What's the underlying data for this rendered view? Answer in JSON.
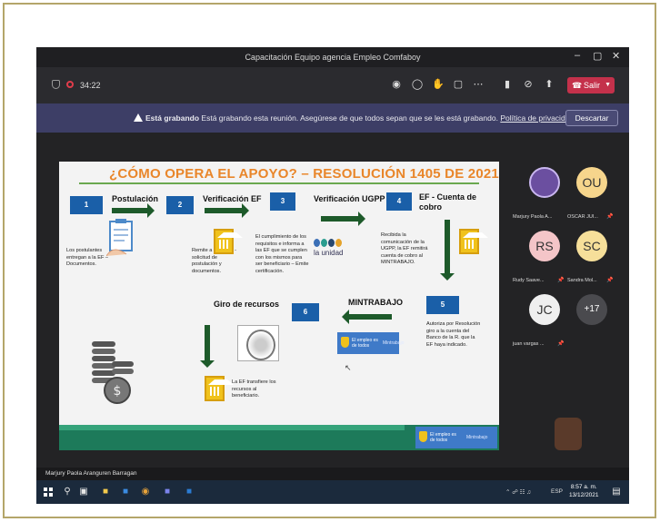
{
  "window": {
    "title": "Capacitación Equipo agencia Empleo Comfaboy",
    "minimize": "–",
    "maximize": "▢",
    "close": "✕"
  },
  "toolbar": {
    "timer": "34:22",
    "leave_label": "Salir"
  },
  "banner": {
    "bold": "Está grabando",
    "text": " Está grabando esta reunión. Asegúrese de que todos sepan que se les está grabando. ",
    "link": "Política de privacidad",
    "discard_label": "Descartar"
  },
  "slide": {
    "title": "¿CÓMO OPERA EL APOYO? – RESOLUCIÓN 1405 DE 2021",
    "steps": {
      "s1": "1",
      "s2": "2",
      "s3": "3",
      "s4": "4",
      "s5": "5",
      "s6": "6"
    },
    "labels": {
      "postulacion": "Postulación",
      "verificacion_ef": "Verificación EF",
      "verificacion_ugpp": "Verificación UGPP",
      "cuenta_cobro": "EF - Cuenta de cobro",
      "mintrabajo": "MINTRABAJO",
      "giro": "Giro de recursos"
    },
    "texts": {
      "t1": "Los postulantes entregan a la EF – Documentos.",
      "t2": "Remite a la UGPP - solicitud de postulación y documentos.",
      "t3": "El cumplimiento de los requisitos e informa a las EF que se cumplen con los mismos para ser beneficiario – Emite certificación.",
      "t4": "Recibida la comunicación de la UGPP, la EF remitirá cuenta de cobro al MINTRABAJO.",
      "t5": "Autoriza por Resolución giro a la cuenta del Banco de la R. que la EF haya indicado.",
      "t6": "La EF transfiere los recursos al beneficiario."
    },
    "unidad": "la unidad",
    "brand_a": "El empleo es de todos",
    "brand_b": "Mintrabajo"
  },
  "participants": [
    {
      "name": "Marjury Paola A...",
      "initials": "",
      "color": "#6b4fa0"
    },
    {
      "name": "OSCAR JUI...",
      "initials": "OU",
      "color": "#f6d58c"
    },
    {
      "name": "Rudy Saave...",
      "initials": "RS",
      "color": "#f4c5c8"
    },
    {
      "name": "Sandra Mol...",
      "initials": "SC",
      "color": "#f6df9a"
    },
    {
      "name": "juan vargas ...",
      "initials": "JC",
      "color": "#efefef"
    },
    {
      "name": "",
      "initials": "+17",
      "color": "#4a4a4e"
    }
  ],
  "presenter_name": "Marjury Paola Aranguren Barragan",
  "taskbar": {
    "time": "8:57 a. m.",
    "date": "13/12/2021",
    "lang": "ESP"
  },
  "colors": {
    "accent_orange": "#e9862a",
    "step_blue": "#1a5fa8",
    "arrow_green": "#1d5a2a",
    "leave_red": "#c4314b",
    "banner_purple": "#3d3e66"
  }
}
